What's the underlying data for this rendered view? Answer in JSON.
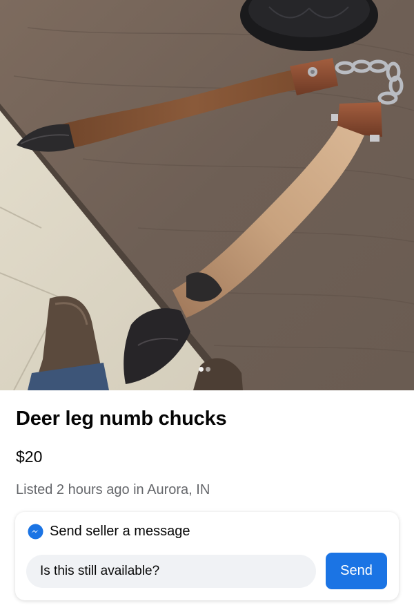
{
  "listing": {
    "title": "Deer leg numb chucks",
    "price": "$20",
    "meta": "Listed 2 hours ago in Aurora, IN"
  },
  "photo": {
    "subject": "deer-leg-nunchucks-photo",
    "carousel_dot_count": 2,
    "active_dot": 1
  },
  "message": {
    "header_label": "Send seller a message",
    "input_value": "Is this still available?",
    "send_label": "Send",
    "icon": "messenger-icon"
  },
  "colors": {
    "accent": "#1b74e4",
    "text_primary": "#050505",
    "text_secondary": "#65676b",
    "input_bg": "#f0f2f5"
  }
}
